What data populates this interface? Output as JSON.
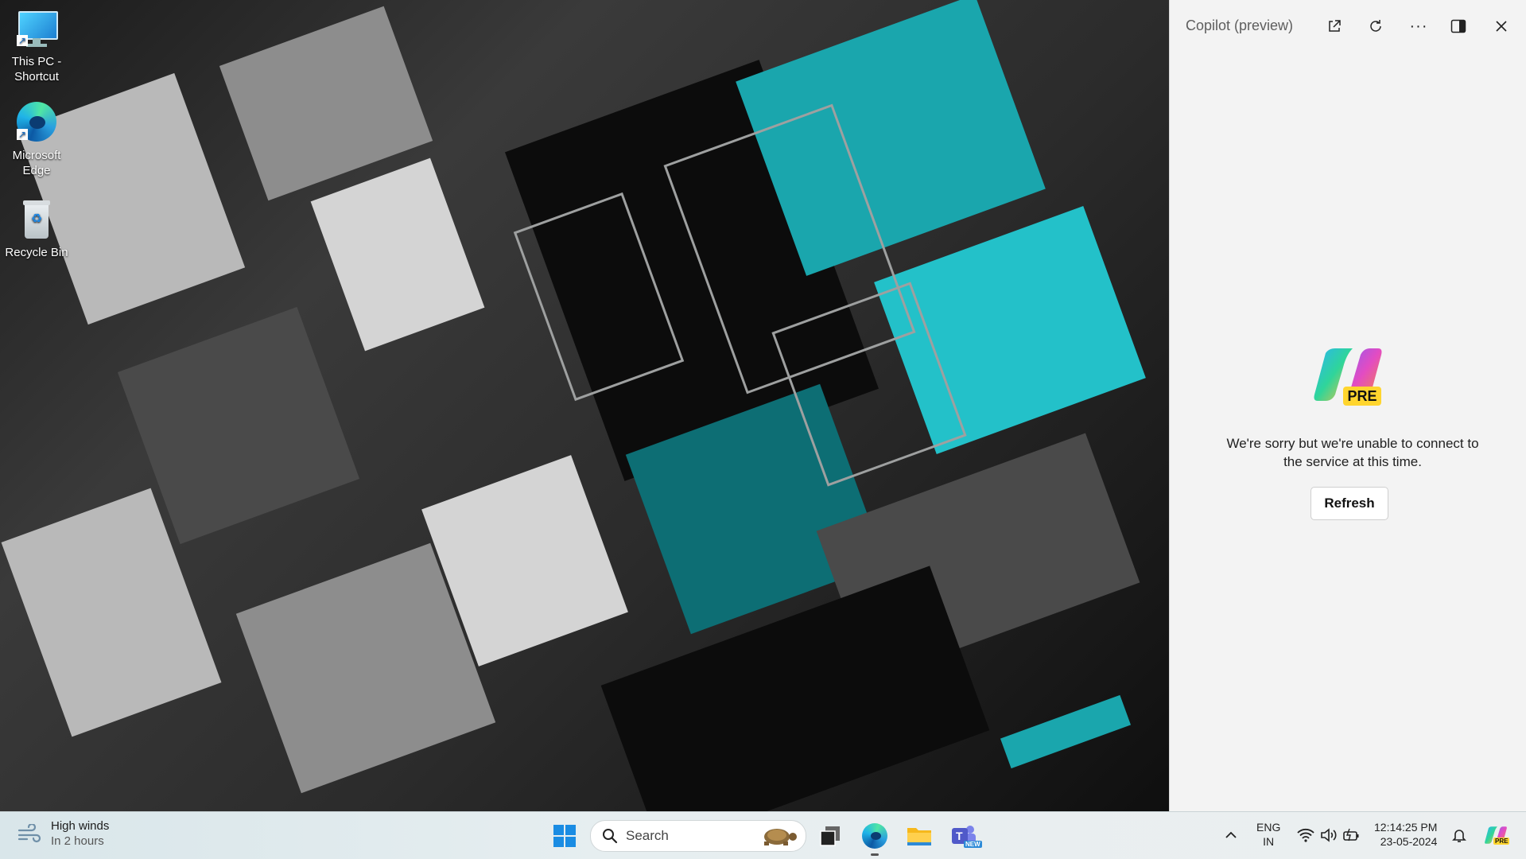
{
  "desktop": {
    "icons": [
      {
        "label": "This PC - Shortcut",
        "line1": "This PC -",
        "line2": "Shortcut"
      },
      {
        "label": "Microsoft Edge",
        "line1": "Microsoft",
        "line2": "Edge"
      },
      {
        "label": "Recycle Bin",
        "line1": "Recycle Bin",
        "line2": ""
      }
    ]
  },
  "copilot": {
    "title": "Copilot (preview)",
    "badge": "PRE",
    "message_line1": "We're sorry but we're unable to connect to",
    "message_line2": "the service at this time.",
    "refresh_label": "Refresh",
    "buttons": [
      "open-in-new-window-icon",
      "refresh-icon",
      "more-options-icon",
      "dock-pane-icon",
      "close-icon"
    ]
  },
  "taskbar": {
    "weather": {
      "title": "High winds",
      "subtitle": "In 2 hours"
    },
    "search_placeholder": "Search",
    "apps": [
      "windows-start-icon",
      "task-view-icon",
      "edge-icon",
      "file-explorer-icon",
      "teams-icon"
    ],
    "teams_badge": "NEW",
    "language": {
      "line1": "ENG",
      "line2": "IN"
    },
    "clock": {
      "time": "12:14:25 PM",
      "date": "23-05-2024"
    },
    "copilot_badge": "PRE"
  },
  "colors": {
    "accent_teal": "#1aa6ad",
    "copilot_bg": "#f3f3f3",
    "taskbar_bg": "#e6eef0"
  }
}
